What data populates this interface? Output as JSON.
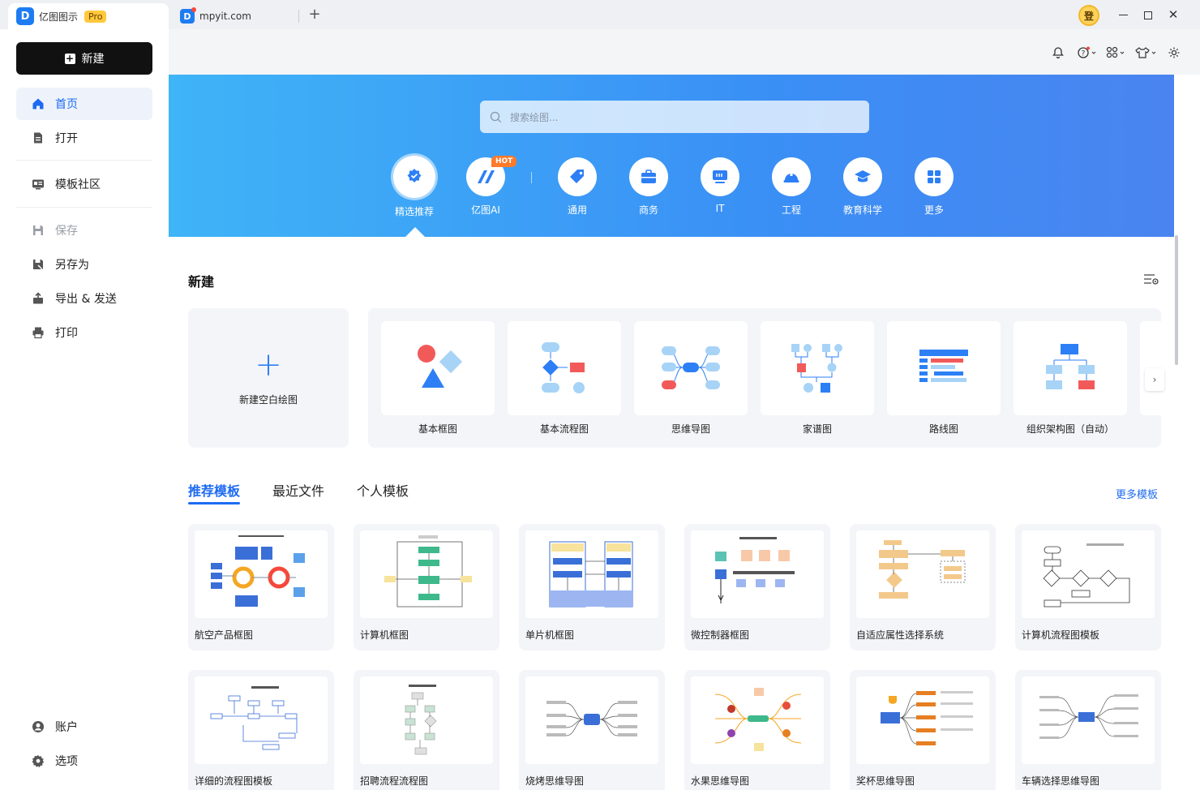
{
  "titlebar": {
    "app_name": "亿图图示",
    "pro_label": "Pro",
    "doc_tab": "mpyit.com",
    "add_tab": "+",
    "login_label": "登",
    "close_label": "✕"
  },
  "sidebar": {
    "new_label": "新建",
    "items": [
      {
        "label": "首页"
      },
      {
        "label": "打开"
      },
      {
        "label": "模板社区"
      },
      {
        "label": "保存"
      },
      {
        "label": "另存为"
      },
      {
        "label": "导出 & 发送"
      },
      {
        "label": "打印"
      }
    ],
    "bottom": [
      {
        "label": "账户"
      },
      {
        "label": "选项"
      }
    ]
  },
  "hero": {
    "search_placeholder": "搜索绘图...",
    "hot_badge": "HOT",
    "categories": [
      {
        "label": "精选推荐"
      },
      {
        "label": "亿图AI"
      },
      {
        "label": "通用"
      },
      {
        "label": "商务"
      },
      {
        "label": "IT"
      },
      {
        "label": "工程"
      },
      {
        "label": "教育科学"
      },
      {
        "label": "更多"
      }
    ]
  },
  "new_section": {
    "title": "新建",
    "blank_label": "新建空白绘图",
    "next_arrow": "›",
    "types": [
      {
        "label": "基本框图"
      },
      {
        "label": "基本流程图"
      },
      {
        "label": "思维导图"
      },
      {
        "label": "家谱图"
      },
      {
        "label": "路线图"
      },
      {
        "label": "组织架构图（自动）"
      }
    ]
  },
  "templates": {
    "tabs": [
      {
        "label": "推荐模板"
      },
      {
        "label": "最近文件"
      },
      {
        "label": "个人模板"
      }
    ],
    "more_label": "更多模板",
    "row1": [
      {
        "label": "航空产品框图"
      },
      {
        "label": "计算机框图"
      },
      {
        "label": "单片机框图"
      },
      {
        "label": "微控制器框图"
      },
      {
        "label": "自适应属性选择系统"
      },
      {
        "label": "计算机流程图模板"
      }
    ],
    "row2": [
      {
        "label": "详细的流程图模板"
      },
      {
        "label": "招聘流程流程图"
      },
      {
        "label": "烧烤思维导图"
      },
      {
        "label": "水果思维导图"
      },
      {
        "label": "奖杯思维导图"
      },
      {
        "label": "车辆选择思维导图"
      }
    ]
  },
  "colors": {
    "accent": "#1e6bf2",
    "hero_start": "#3fb4f7",
    "hero_end": "#4a84f0",
    "new_button": "#111111"
  }
}
